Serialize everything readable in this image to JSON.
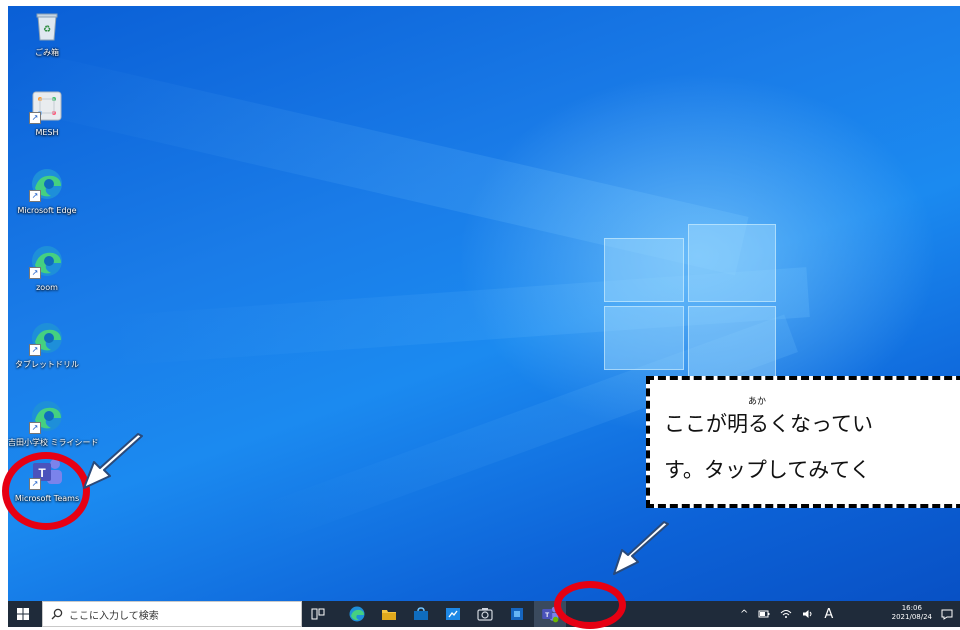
{
  "desktop": {
    "icons": [
      {
        "label": "ごみ箱",
        "icon": "recycle-bin-icon"
      },
      {
        "label": "MESH",
        "icon": "mesh-icon"
      },
      {
        "label": "Microsoft Edge",
        "icon": "edge-icon"
      },
      {
        "label": "zoom",
        "icon": "edge-icon"
      },
      {
        "label": "タブレットドリル",
        "icon": "edge-icon"
      },
      {
        "label": "吉田小学校 ミライシード",
        "icon": "edge-icon"
      },
      {
        "label": "Microsoft Teams",
        "icon": "teams-icon"
      }
    ]
  },
  "callout": {
    "line1": "ここが明るくなってい",
    "line2": "す。タップしてみてく",
    "ruby": "あか"
  },
  "taskbar": {
    "search_placeholder": "ここに入力して検索",
    "time": "16:06",
    "date": "2021/08/24",
    "ime": "A"
  },
  "colors": {
    "highlight_ring": "#e60012",
    "taskbar": "#1f2b3a",
    "wallpaper": "#1a7ce8"
  }
}
